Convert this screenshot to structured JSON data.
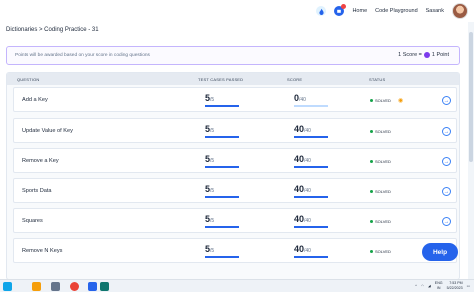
{
  "header": {
    "nav": [
      "Home",
      "Code Playground"
    ],
    "user_name": "Sasank",
    "notification_count": "2"
  },
  "breadcrumb": "Dictionaries > Coding Practice - 31",
  "banner": {
    "message": "Points will be awarded based on your score in coding questions",
    "score_text": "1 Score =",
    "point_text": "1 Point"
  },
  "table": {
    "headers": [
      "QUESTION",
      "TEST CASES PASSED",
      "SCORE",
      "STATUS"
    ],
    "rows": [
      {
        "question": "Add a Key",
        "passed": "5",
        "total": "/5",
        "score": "0",
        "score_total": "/40",
        "status": "SOLVED",
        "progress": 1.0,
        "score_fraction": 0.0,
        "has_eye": true
      },
      {
        "question": "Update Value of Key",
        "passed": "5",
        "total": "/5",
        "score": "40",
        "score_total": "/40",
        "status": "SOLVED",
        "progress": 1.0,
        "score_fraction": 1.0,
        "has_eye": false
      },
      {
        "question": "Remove a Key",
        "passed": "5",
        "total": "/5",
        "score": "40",
        "score_total": "/40",
        "status": "SOLVED",
        "progress": 1.0,
        "score_fraction": 1.0,
        "has_eye": false
      },
      {
        "question": "Sports Data",
        "passed": "5",
        "total": "/5",
        "score": "40",
        "score_total": "/40",
        "status": "SOLVED",
        "progress": 1.0,
        "score_fraction": 1.0,
        "has_eye": false
      },
      {
        "question": "Squares",
        "passed": "5",
        "total": "/5",
        "score": "40",
        "score_total": "/40",
        "status": "SOLVED",
        "progress": 1.0,
        "score_fraction": 1.0,
        "has_eye": false
      },
      {
        "question": "Remove N Keys",
        "passed": "5",
        "total": "/5",
        "score": "40",
        "score_total": "/40",
        "status": "SOLVED",
        "progress": 1.0,
        "score_fraction": 1.0,
        "has_eye": false
      }
    ]
  },
  "help_label": "Help",
  "taskbar": {
    "lang_top": "ENG",
    "lang_bottom": "IN",
    "time": "7:53 PM",
    "date": "5/22/2023"
  },
  "colors": {
    "accent": "#2563eb",
    "solved": "#16a34a",
    "banner_border": "#c4b5fd"
  }
}
